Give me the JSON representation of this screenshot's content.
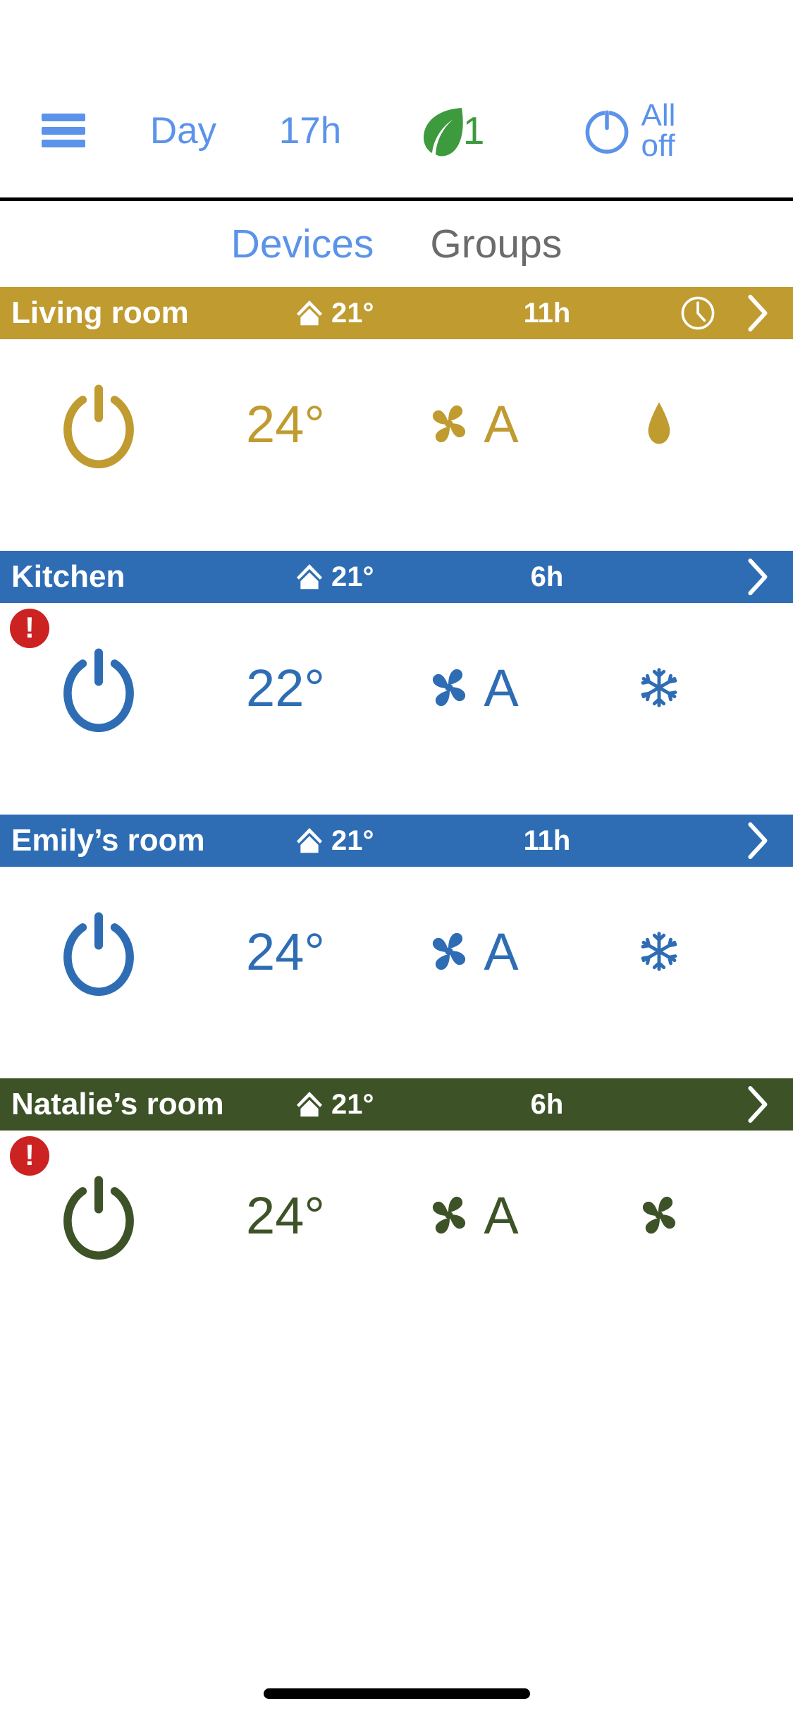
{
  "toolbar": {
    "menu_icon": "hamburger-menu-icon",
    "mode_label": "Day",
    "hours_label": "17h",
    "eco_icon": "leaf-icon",
    "eco_count": "1",
    "power_icon": "power-icon",
    "all_off_label": "All\noff",
    "accent_color": "#5b93ea",
    "leaf_color": "#3d9a3d"
  },
  "tabs": {
    "devices": "Devices",
    "groups": "Groups",
    "active": "Devices",
    "active_color": "#5b93ea",
    "inactive_color": "#6b6b6b"
  },
  "rooms": [
    {
      "name": "Living room",
      "color": "#bf9b30",
      "home_icon": "home-icon",
      "ambient_temp": "21°",
      "hours": "11h",
      "has_clock": true,
      "clock_icon": "clock-icon",
      "chevron_icon": "chevron-right-icon",
      "alert": false,
      "alert_icon": "alert-icon",
      "power_icon": "power-icon",
      "set_temp": "24°",
      "fan_icon": "fan-icon",
      "fan_speed": "A",
      "mode_icon": "water-drop-icon"
    },
    {
      "name": "Kitchen",
      "color": "#2e6db4",
      "home_icon": "home-icon",
      "ambient_temp": "21°",
      "hours": "6h",
      "has_clock": false,
      "clock_icon": "clock-icon",
      "chevron_icon": "chevron-right-icon",
      "alert": true,
      "alert_icon": "alert-icon",
      "power_icon": "power-icon",
      "set_temp": "22°",
      "fan_icon": "fan-icon",
      "fan_speed": "A",
      "mode_icon": "snowflake-icon"
    },
    {
      "name": "Emily’s room",
      "color": "#2e6db4",
      "home_icon": "home-icon",
      "ambient_temp": "21°",
      "hours": "11h",
      "has_clock": false,
      "clock_icon": "clock-icon",
      "chevron_icon": "chevron-right-icon",
      "alert": false,
      "alert_icon": "alert-icon",
      "power_icon": "power-icon",
      "set_temp": "24°",
      "fan_icon": "fan-icon",
      "fan_speed": "A",
      "mode_icon": "snowflake-icon"
    },
    {
      "name": "Natalie’s room",
      "color": "#3d5327",
      "home_icon": "home-icon",
      "ambient_temp": "21°",
      "hours": "6h",
      "has_clock": false,
      "clock_icon": "clock-icon",
      "chevron_icon": "chevron-right-icon",
      "alert": true,
      "alert_icon": "alert-icon",
      "power_icon": "power-icon",
      "set_temp": "24°",
      "fan_icon": "fan-icon",
      "fan_speed": "A",
      "mode_icon": "fan-icon"
    }
  ],
  "alert_badge": {
    "symbol": "!",
    "color": "#cc2222"
  },
  "home_indicator": {
    "color": "#000000"
  }
}
